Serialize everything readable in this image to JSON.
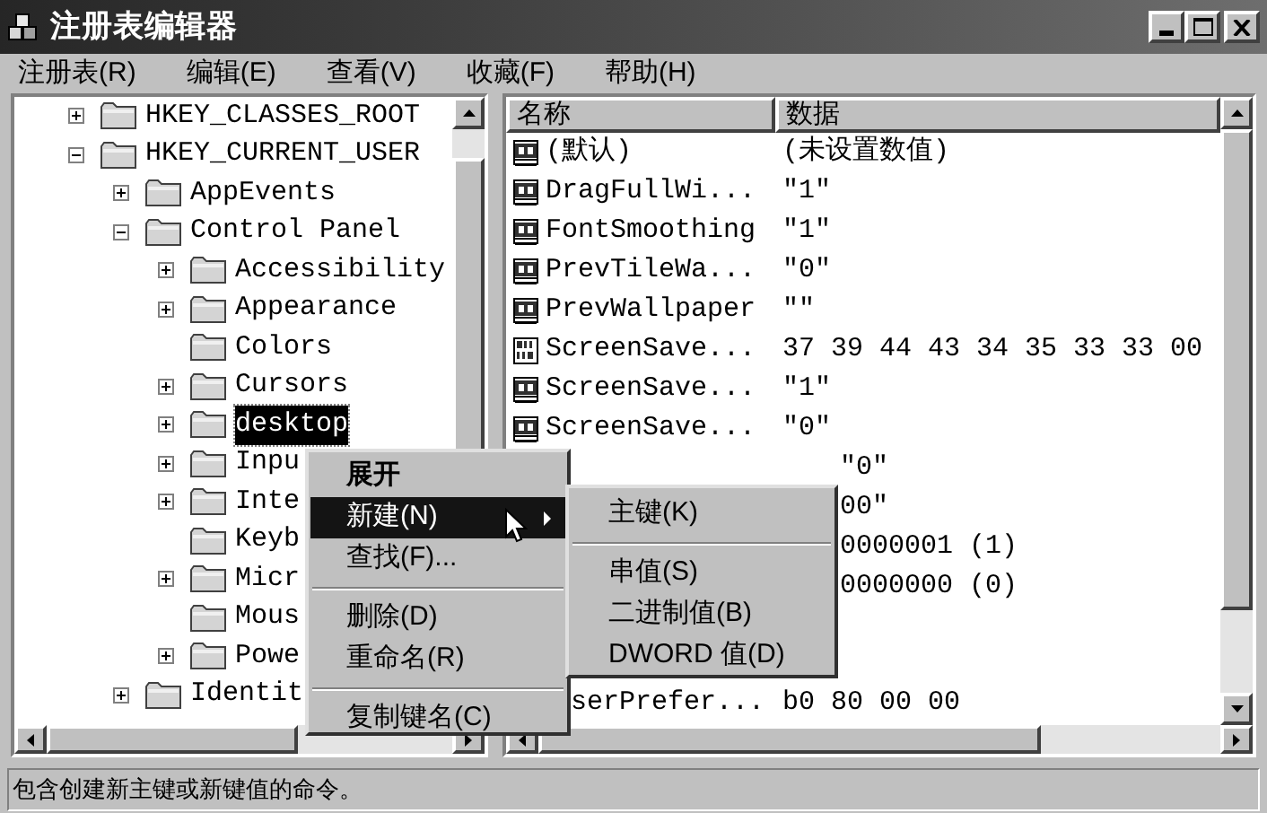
{
  "window": {
    "title": "注册表编辑器"
  },
  "menu_bar": [
    "注册表(R)",
    "编辑(E)",
    "查看(V)",
    "收藏(F)",
    "帮助(H)"
  ],
  "tree": [
    {
      "kind": "branch",
      "label": "HKEY_CLASSES_ROOT",
      "expanded": false,
      "selected": false
    },
    {
      "kind": "branch",
      "label": "HKEY_CURRENT_USER",
      "expanded": true,
      "selected": false,
      "children": [
        {
          "kind": "branch",
          "label": "AppEvents",
          "expanded": false,
          "selected": false
        },
        {
          "kind": "branch",
          "label": "Control Panel",
          "expanded": true,
          "selected": false,
          "children": [
            {
              "kind": "branch",
              "label": "Accessibility",
              "expanded": false,
              "selected": false
            },
            {
              "kind": "branch",
              "label": "Appearance",
              "expanded": false,
              "selected": false
            },
            {
              "kind": "leaf",
              "label": "Colors",
              "selected": false
            },
            {
              "kind": "branch",
              "label": "Cursors",
              "expanded": false,
              "selected": false
            },
            {
              "kind": "branch",
              "label": "desktop",
              "expanded": false,
              "selected": true
            },
            {
              "kind": "branch",
              "label": "Inpu",
              "expanded": false,
              "selected": false
            },
            {
              "kind": "branch",
              "label": "Inte",
              "expanded": false,
              "selected": false
            },
            {
              "kind": "leaf",
              "label": "Keyb",
              "selected": false
            },
            {
              "kind": "branch",
              "label": "Micr",
              "expanded": false,
              "selected": false
            },
            {
              "kind": "leaf",
              "label": "Mous",
              "selected": false
            },
            {
              "kind": "branch",
              "label": "Powe",
              "expanded": false,
              "selected": false
            }
          ]
        },
        {
          "kind": "branch",
          "label": "Identit",
          "expanded": false,
          "selected": false
        }
      ]
    }
  ],
  "list": {
    "columns": [
      "名称",
      "数据"
    ],
    "rows": [
      {
        "kind": "string",
        "name": "(默认)",
        "data": "(未设置数值)"
      },
      {
        "kind": "string",
        "name": "DragFullWi...",
        "data": "\"1\""
      },
      {
        "kind": "string",
        "name": "FontSmoothing",
        "data": "\"1\""
      },
      {
        "kind": "string",
        "name": "PrevTileWa...",
        "data": "\"0\""
      },
      {
        "kind": "string",
        "name": "PrevWallpaper",
        "data": "\"\""
      },
      {
        "kind": "binary",
        "name": "ScreenSave...",
        "data": "37 39 44 43 34 35 33 33 00"
      },
      {
        "kind": "string",
        "name": "ScreenSave...",
        "data": "\"1\""
      },
      {
        "kind": "string",
        "name": "ScreenSave...",
        "data": "\"0\""
      },
      {
        "kind": "covered",
        "data": "\"0\""
      },
      {
        "kind": "covered",
        "data": "00\""
      },
      {
        "kind": "covered",
        "data": "0000001 (1)"
      },
      {
        "kind": "covered",
        "data": "0000000 (0)"
      }
    ],
    "bottom_row": {
      "name": "serPrefer...",
      "data": "b0 80 00 00"
    }
  },
  "context_menu": {
    "items": [
      {
        "kind": "item",
        "label": "展开",
        "bold": true,
        "selected": false,
        "submenu": false
      },
      {
        "kind": "item",
        "label": "新建(N)",
        "bold": false,
        "selected": true,
        "submenu": true
      },
      {
        "kind": "item",
        "label": "查找(F)...",
        "bold": false,
        "selected": false,
        "submenu": false
      },
      {
        "kind": "separator"
      },
      {
        "kind": "item",
        "label": "删除(D)",
        "bold": false,
        "selected": false,
        "submenu": false
      },
      {
        "kind": "item",
        "label": "重命名(R)",
        "bold": false,
        "selected": false,
        "submenu": false
      },
      {
        "kind": "separator"
      },
      {
        "kind": "item",
        "label": "复制键名(C)",
        "bold": false,
        "selected": false,
        "submenu": false
      }
    ]
  },
  "submenu": {
    "items": [
      {
        "kind": "item",
        "label": "主键(K)"
      },
      {
        "kind": "separator"
      },
      {
        "kind": "item",
        "label": "串值(S)"
      },
      {
        "kind": "item",
        "label": "二进制值(B)"
      },
      {
        "kind": "item",
        "label": "DWORD 值(D)"
      }
    ]
  },
  "status_bar": "包含创建新主键或新键值的命令。"
}
